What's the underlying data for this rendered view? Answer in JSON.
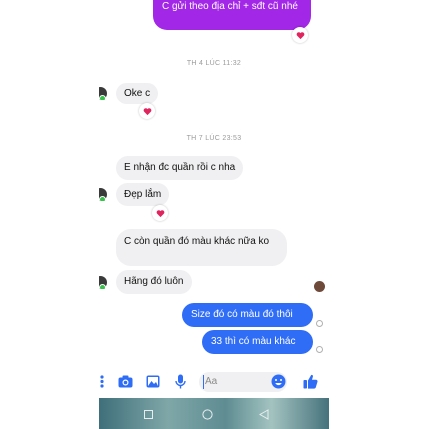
{
  "top_message": {
    "text": "C gửi theo địa chỉ + sđt cũ nhé"
  },
  "timestamps": {
    "first": "TH 4 LÚC 11:32",
    "second": "TH 7 LÚC 23:53"
  },
  "messages": [
    {
      "text": "Oke c"
    },
    {
      "text": "E nhận đc quần rồi c nha"
    },
    {
      "text": "Đẹp lắm"
    },
    {
      "text": "C còn quần đó màu khác nữa ko"
    },
    {
      "text": "Hãng đó luôn"
    },
    {
      "text": "Size đó có màu đó thôi"
    },
    {
      "text": "33 thì có màu khác"
    }
  ],
  "composer": {
    "placeholder": "Aa"
  },
  "icons": {
    "menu": "more-vertical-icon",
    "camera": "camera-icon",
    "gallery": "image-icon",
    "mic": "microphone-icon",
    "emoji": "emoji-icon",
    "like": "thumbs-up-icon",
    "reaction": "heart-icon"
  },
  "colors": {
    "outgoing": "#2f6df6",
    "incoming": "#f0f0f2",
    "purple": "#a227e6",
    "reaction": "#e0245e"
  }
}
